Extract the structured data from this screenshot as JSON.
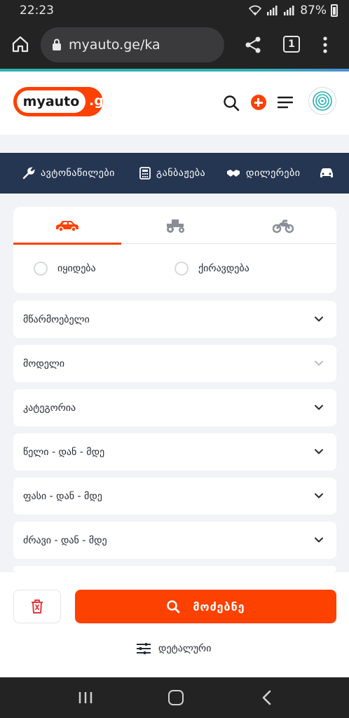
{
  "status_bar": {
    "time": "22:23",
    "battery": "87%"
  },
  "browser": {
    "url": "myauto.ge/ka",
    "tab_count": "1"
  },
  "site": {
    "logo_main": "myauto",
    "logo_suffix": ".ge"
  },
  "nav": {
    "items": [
      {
        "label": "ავტონაწილები",
        "icon": "wrench-icon"
      },
      {
        "label": "განბაჟება",
        "icon": "calculator-icon"
      },
      {
        "label": "დილერები",
        "icon": "handshake-icon"
      },
      {
        "label": "",
        "icon": "car-icon"
      }
    ]
  },
  "search": {
    "vehicle_tabs": [
      {
        "name": "car",
        "icon": "car-icon",
        "active": true
      },
      {
        "name": "tractor",
        "icon": "tractor-icon",
        "active": false
      },
      {
        "name": "motorcycle",
        "icon": "motorcycle-icon",
        "active": false
      }
    ],
    "deal_types": [
      "იყიდება",
      "ქირავდება"
    ],
    "fields": [
      {
        "label": "მწარმოებელი",
        "enabled": true
      },
      {
        "label": "მოდელი",
        "enabled": false
      },
      {
        "label": "კატეგორია",
        "enabled": true
      },
      {
        "label": "წელი - დან - მდე",
        "enabled": true
      },
      {
        "label": "ფასი - დან - მდე",
        "enabled": true
      },
      {
        "label": "ძრავი - დან - მდე",
        "enabled": true
      }
    ],
    "search_button": "მოძებნე",
    "detailed_link": "დეტალური"
  },
  "colors": {
    "accent": "#fd4100",
    "nav_bg": "#253652",
    "page_bg": "#f2f3f6"
  }
}
